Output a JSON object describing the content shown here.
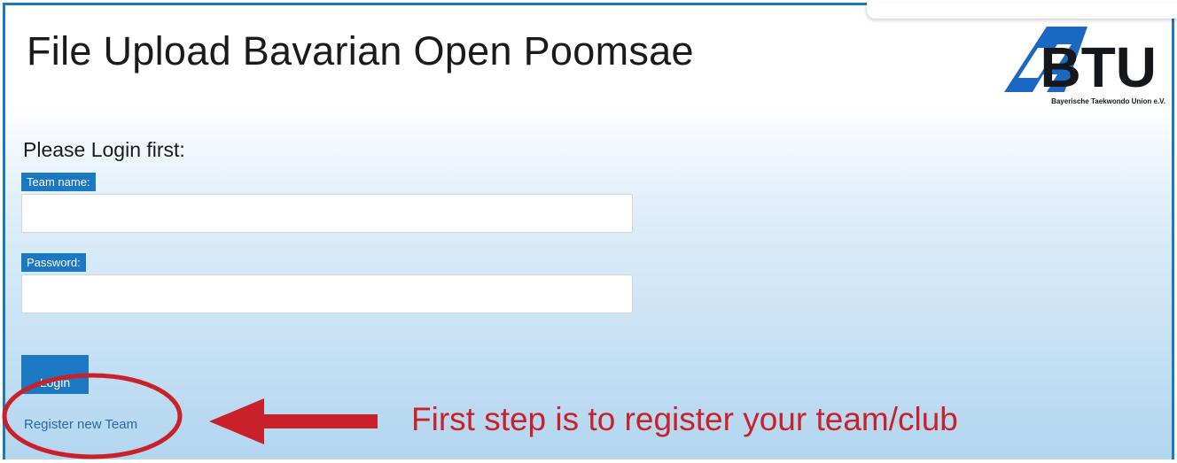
{
  "header": {
    "title": "File Upload Bavarian Open Poomsae",
    "logo": {
      "text": "BTU",
      "subtitle": "Bayerische Taekwondo Union e.V."
    }
  },
  "login": {
    "heading": "Please Login first:",
    "team_name_label": "Team name:",
    "team_name_value": "",
    "password_label": "Password:",
    "password_value": "",
    "login_button": "Login",
    "register_link": "Register new Team"
  },
  "annotation": {
    "text": "First step is to register your team/club",
    "color": "#c8212a"
  },
  "colors": {
    "accent": "#1b78c2",
    "link": "#1f69ad"
  }
}
